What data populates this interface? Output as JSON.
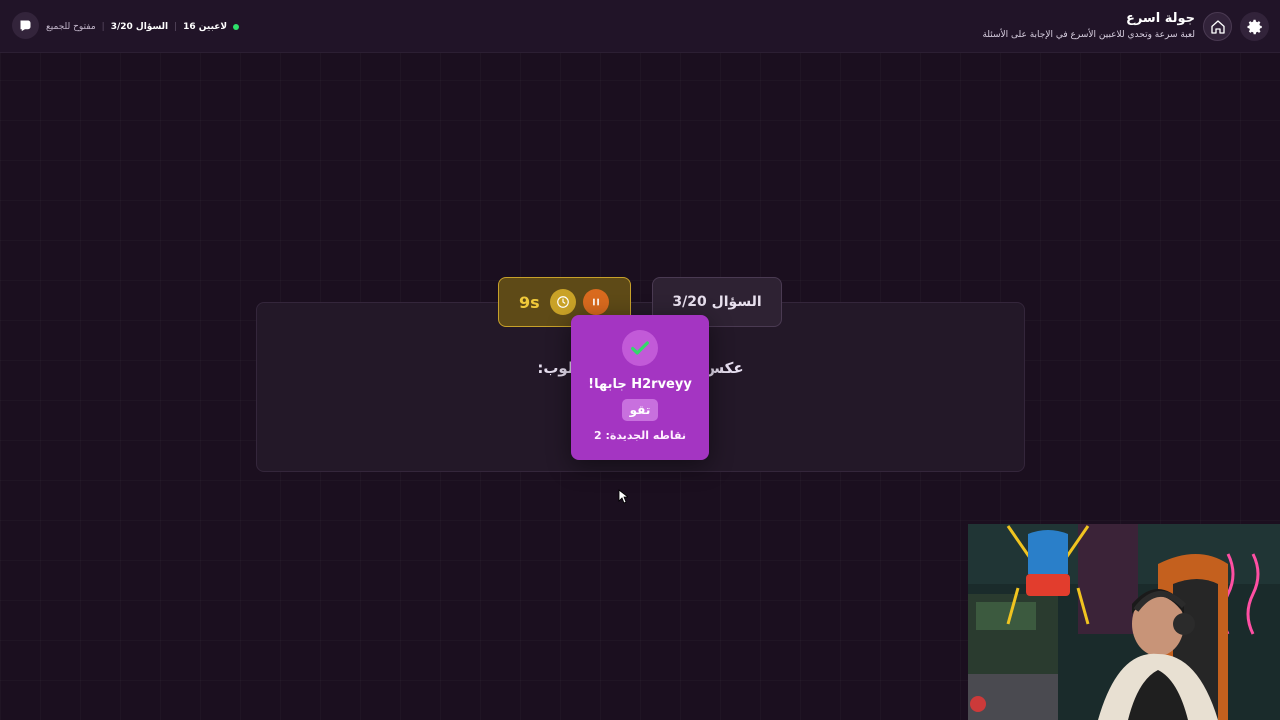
{
  "header": {
    "title": "جولة اسرع",
    "subtitle": "لعبة سرعة وتحدي للاعبين الأسرع في الإجابة على الأسئلة",
    "status_players": "16 لاعبين",
    "status_question": "السؤال 3/20",
    "status_open": "مفتوح للجميع"
  },
  "game": {
    "timer": "9s",
    "question_counter": "السؤال 3/20",
    "question_text_left": "عكس",
    "question_text_right": "لوب:"
  },
  "popup": {
    "winner_text": "H2rveyy جابها!",
    "answer": "تقو",
    "points_text": "نقاطه الجديدة: 2"
  },
  "colors": {
    "background": "#1b0f1f",
    "popup": "#a435c2",
    "timer_border": "#c7a12a",
    "online_dot": "#2ee06a"
  },
  "icons": [
    "gear-icon",
    "home-icon",
    "logo-icon",
    "clock-icon",
    "pause-icon",
    "check-icon"
  ]
}
